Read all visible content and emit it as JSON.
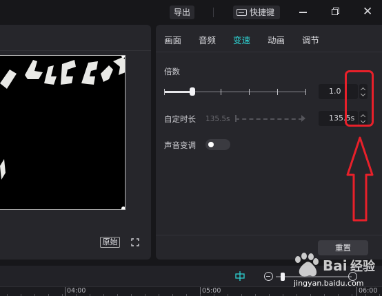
{
  "titlebar": {
    "export_label": "导出",
    "shortcut_label": "快捷键",
    "close_glyph": "✕"
  },
  "player": {
    "original_label": "原始"
  },
  "panel": {
    "tabs": [
      {
        "label": "画面",
        "active": false
      },
      {
        "label": "音频",
        "active": false
      },
      {
        "label": "变速",
        "active": true
      },
      {
        "label": "动画",
        "active": false
      },
      {
        "label": "调节",
        "active": false
      }
    ],
    "speed": {
      "label": "倍数",
      "value": "1.0",
      "level": 0.2
    },
    "duration": {
      "label": "自定时长",
      "disabled_value": "135.5s",
      "value": "135.5s"
    },
    "pitch": {
      "label": "声音变调",
      "enabled": false
    },
    "reset_label": "重置"
  },
  "timeline": {
    "ruler_labels": [
      "04:00",
      "05:00",
      "06:00"
    ]
  },
  "watermark": {
    "text": "jingyan.baidu.com"
  },
  "colors": {
    "accent": "#2ed3d3",
    "annotation": "#e8202a",
    "panel_bg": "#26262b",
    "app_bg": "#17171a"
  }
}
